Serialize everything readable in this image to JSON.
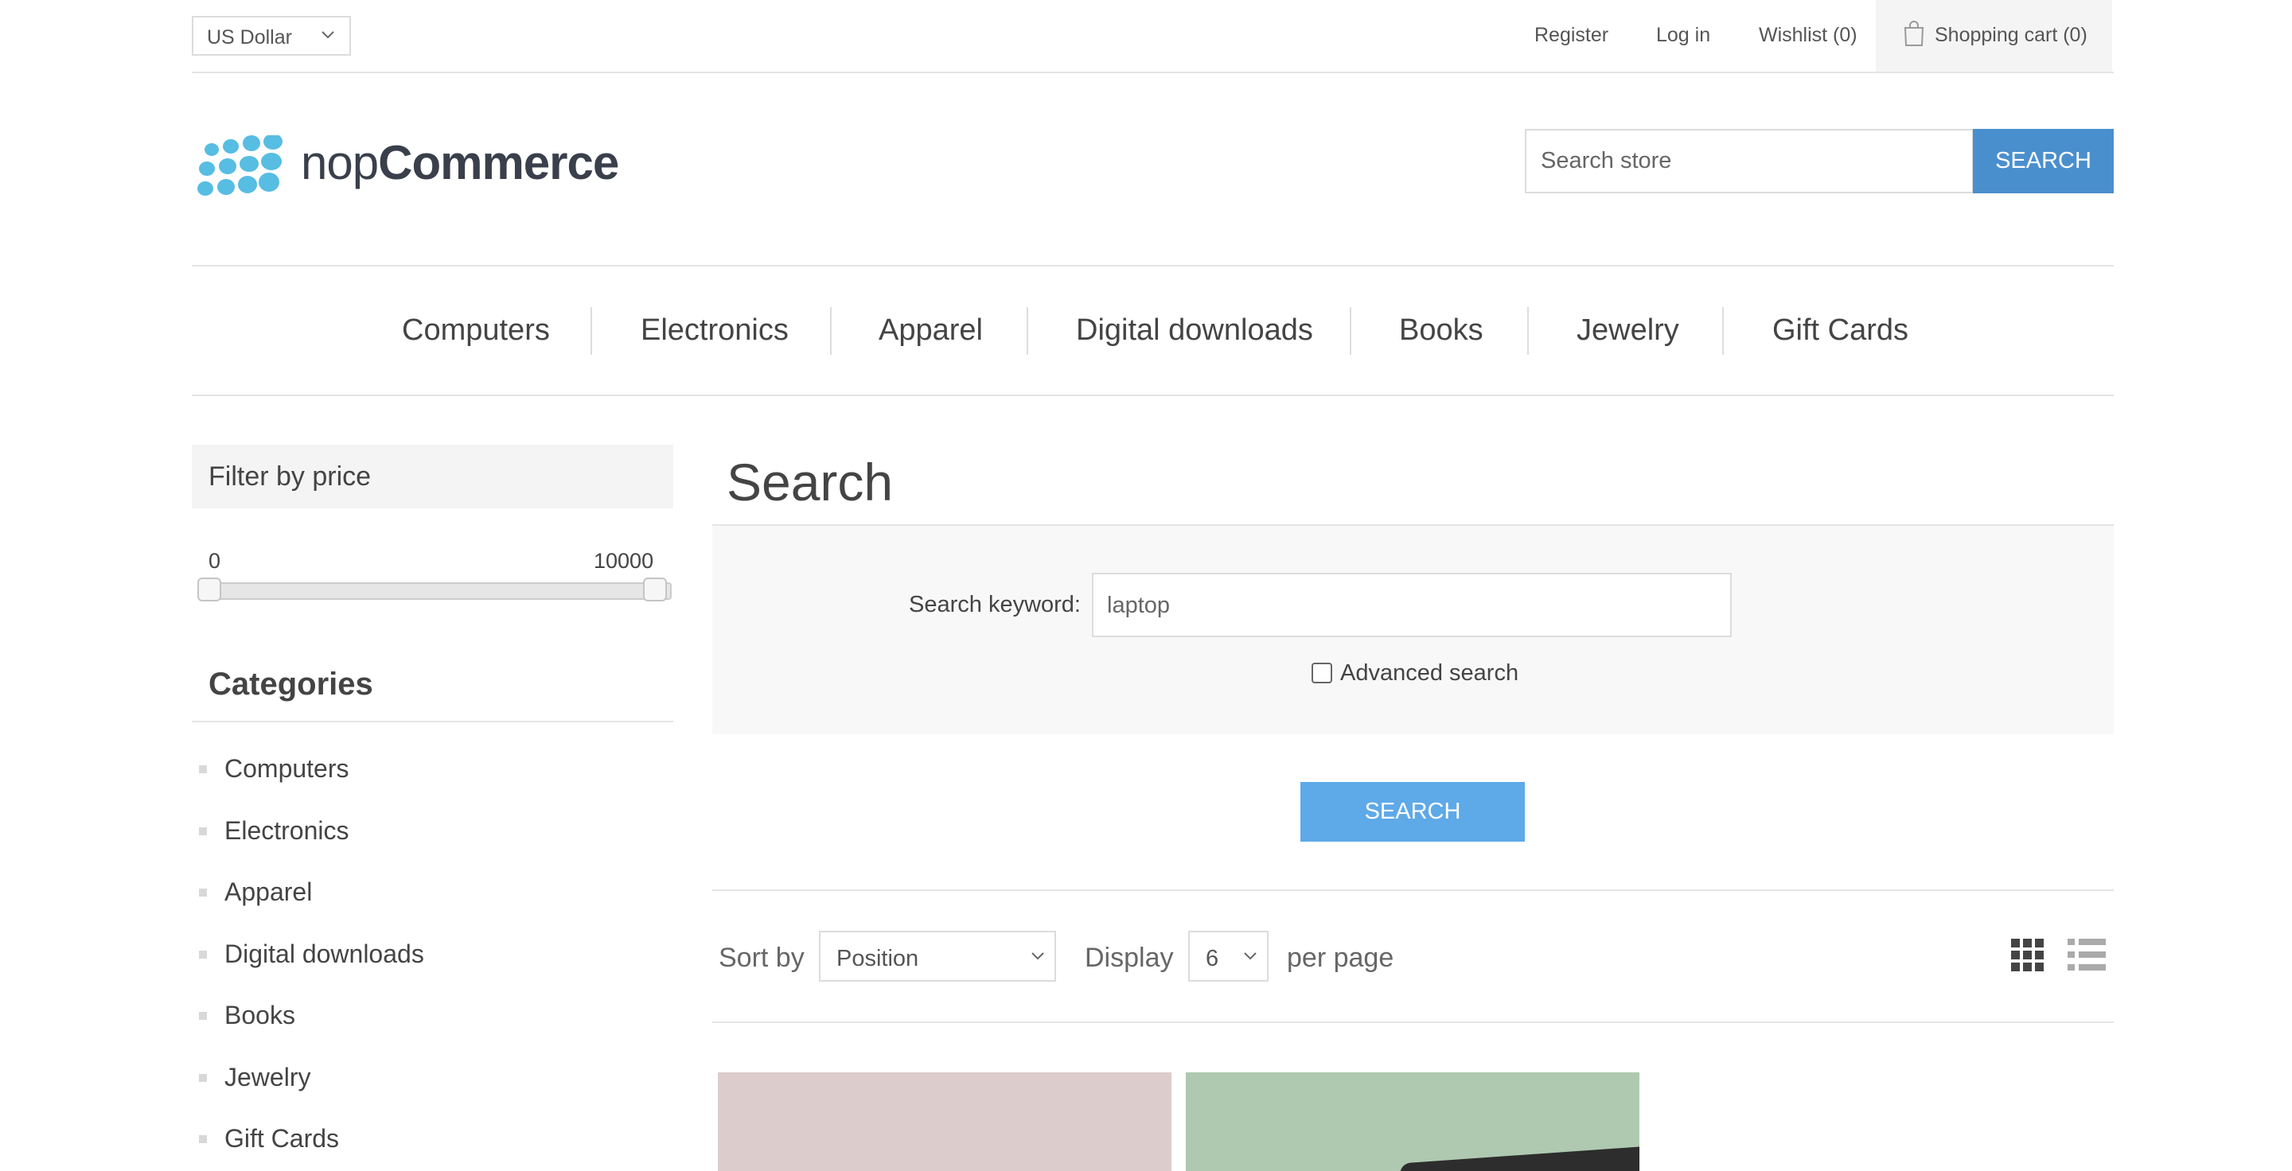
{
  "header": {
    "currency": "US Dollar",
    "links": {
      "register": "Register",
      "login": "Log in",
      "wishlist": "Wishlist (0)",
      "cart": "Shopping cart (0)"
    }
  },
  "logo": {
    "text_light": "nop",
    "text_bold": "Commerce",
    "color": "#57bde3"
  },
  "store_search": {
    "placeholder": "Search store",
    "button": "SEARCH"
  },
  "nav": [
    "Computers",
    "Electronics",
    "Apparel",
    "Digital downloads",
    "Books",
    "Jewelry",
    "Gift Cards"
  ],
  "sidebar": {
    "filter_title": "Filter by price",
    "price_min": "0",
    "price_max": "10000",
    "categories_title": "Categories",
    "categories": [
      "Computers",
      "Electronics",
      "Apparel",
      "Digital downloads",
      "Books",
      "Jewelry",
      "Gift Cards"
    ]
  },
  "main": {
    "title": "Search",
    "keyword_label": "Search keyword:",
    "keyword_value": "laptop",
    "advanced_label": "Advanced search",
    "search_button": "SEARCH",
    "sort_label": "Sort by",
    "sort_value": "Position",
    "display_label": "Display",
    "display_value": "6",
    "per_page_label": "per page"
  },
  "icons": {
    "cart": "shopping-bag-icon",
    "grid": "grid-view-icon",
    "list": "list-view-icon"
  },
  "colors": {
    "accent": "#4a8fcd",
    "search_button": "#5ea9e8"
  }
}
